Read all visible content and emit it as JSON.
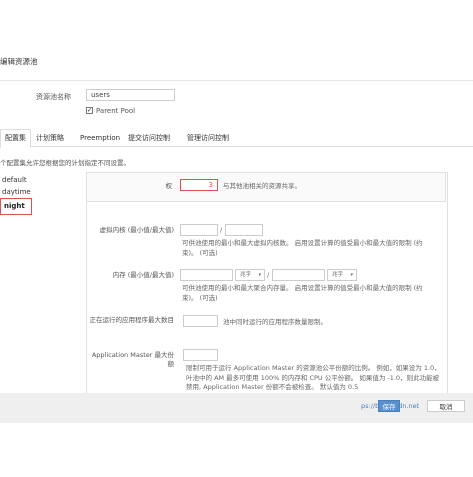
{
  "dialog": {
    "title": "编辑资源池"
  },
  "pool": {
    "name_label": "资源池名称",
    "name_value": "users",
    "parent_pool_label": "Parent Pool",
    "parent_pool_checked": true
  },
  "tabs": [
    {
      "label": "配置集"
    },
    {
      "label": "计划策略"
    },
    {
      "label": "Preemption"
    },
    {
      "label": "提交访问控制"
    },
    {
      "label": "管理访问控制"
    }
  ],
  "help_text": "个配置集允许您根据您的计划指定不同设置。",
  "sidebar": {
    "items": [
      "default",
      "daytime",
      "night"
    ],
    "selected": "night"
  },
  "form": {
    "weight": {
      "label": "权",
      "value": "3",
      "hint": "与其他池相关的资源共享。"
    },
    "vcores": {
      "label": "虚拟内核 (最小值/最大值)",
      "separator": "/",
      "hint": "可供池使用的最小和最大虚拟内核数。 启用设置计算的值受最小和最大值的限制 (约束)。 (可选)"
    },
    "memory": {
      "label": "内存 (最小值/最大值)",
      "unit": "兆字",
      "separator": "/",
      "hint": "可供池使用的最小和最大聚合内存量。 启用设置计算的值受最小和最大值的限制 (约束)。 (可选)"
    },
    "running_apps": {
      "label": "正在运行的应用程序最大数目",
      "hint": "池中同时运行的应用程序数量限制。"
    },
    "am_share": {
      "label": "Application Master 最大份额",
      "hint": "限制可用于运行 Application Master 的资源池公平份额的比例。 例如，如果设为 1.0，叶池中的 AM 最多可使用 100% 的内存和 CPU 公平份额。 如果值为 -1.0，则此功能被禁用, Application Master 份额不会被检查。 默认值为 0.5"
    }
  },
  "footer": {
    "watermark": "ps://blog.csdn.net",
    "save_label": "保存",
    "cancel_label": "取消"
  },
  "colors": {
    "accent": "#5a8fce",
    "highlight": "#d9534f"
  }
}
